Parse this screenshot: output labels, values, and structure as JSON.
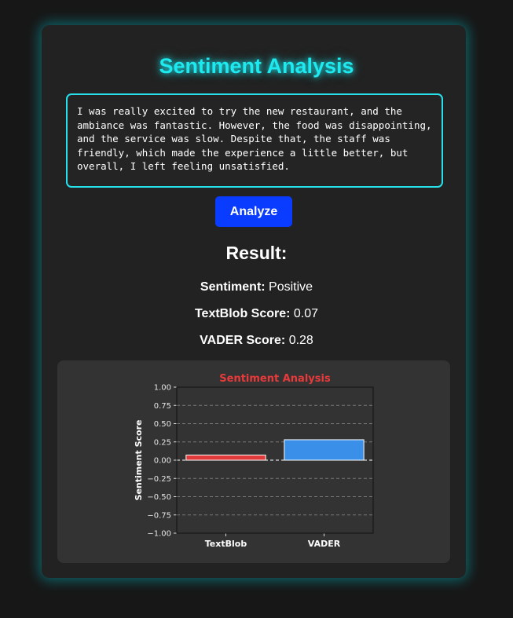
{
  "app": {
    "title": "Sentiment Analysis",
    "input_text": "I was really excited to try the new restaurant, and the ambiance was fantastic. However, the food was disappointing, and the service was slow. Despite that, the staff was friendly, which made the experience a little better, but overall, I left feeling unsatisfied.",
    "analyze_label": "Analyze"
  },
  "result": {
    "heading": "Result:",
    "sentiment_label": "Sentiment:",
    "sentiment_value": "Positive",
    "textblob_label": "TextBlob Score:",
    "textblob_value": "0.07",
    "vader_label": "VADER Score:",
    "vader_value": "0.28"
  },
  "colors": {
    "accent": "#1de9ef",
    "button": "#0a3cff",
    "chart_title": "#e83a3a",
    "textblob_bar": "#e03a3a",
    "vader_bar": "#3a8fe8"
  },
  "chart_data": {
    "type": "bar",
    "title": "Sentiment Analysis",
    "xlabel": "",
    "ylabel": "Sentiment Score",
    "categories": [
      "TextBlob",
      "VADER"
    ],
    "values": [
      0.07,
      0.28
    ],
    "bar_colors": [
      "#e03a3a",
      "#3a8fe8"
    ],
    "ylim": [
      -1.0,
      1.0
    ],
    "yticks": [
      1.0,
      0.75,
      0.5,
      0.25,
      0.0,
      -0.25,
      -0.5,
      -0.75,
      -1.0
    ],
    "ytick_labels": [
      "1.00",
      "0.75",
      "0.50",
      "0.25",
      "0.00",
      "−0.25",
      "−0.50",
      "−0.75",
      "−1.00"
    ],
    "grid": true,
    "baseline": 0
  }
}
